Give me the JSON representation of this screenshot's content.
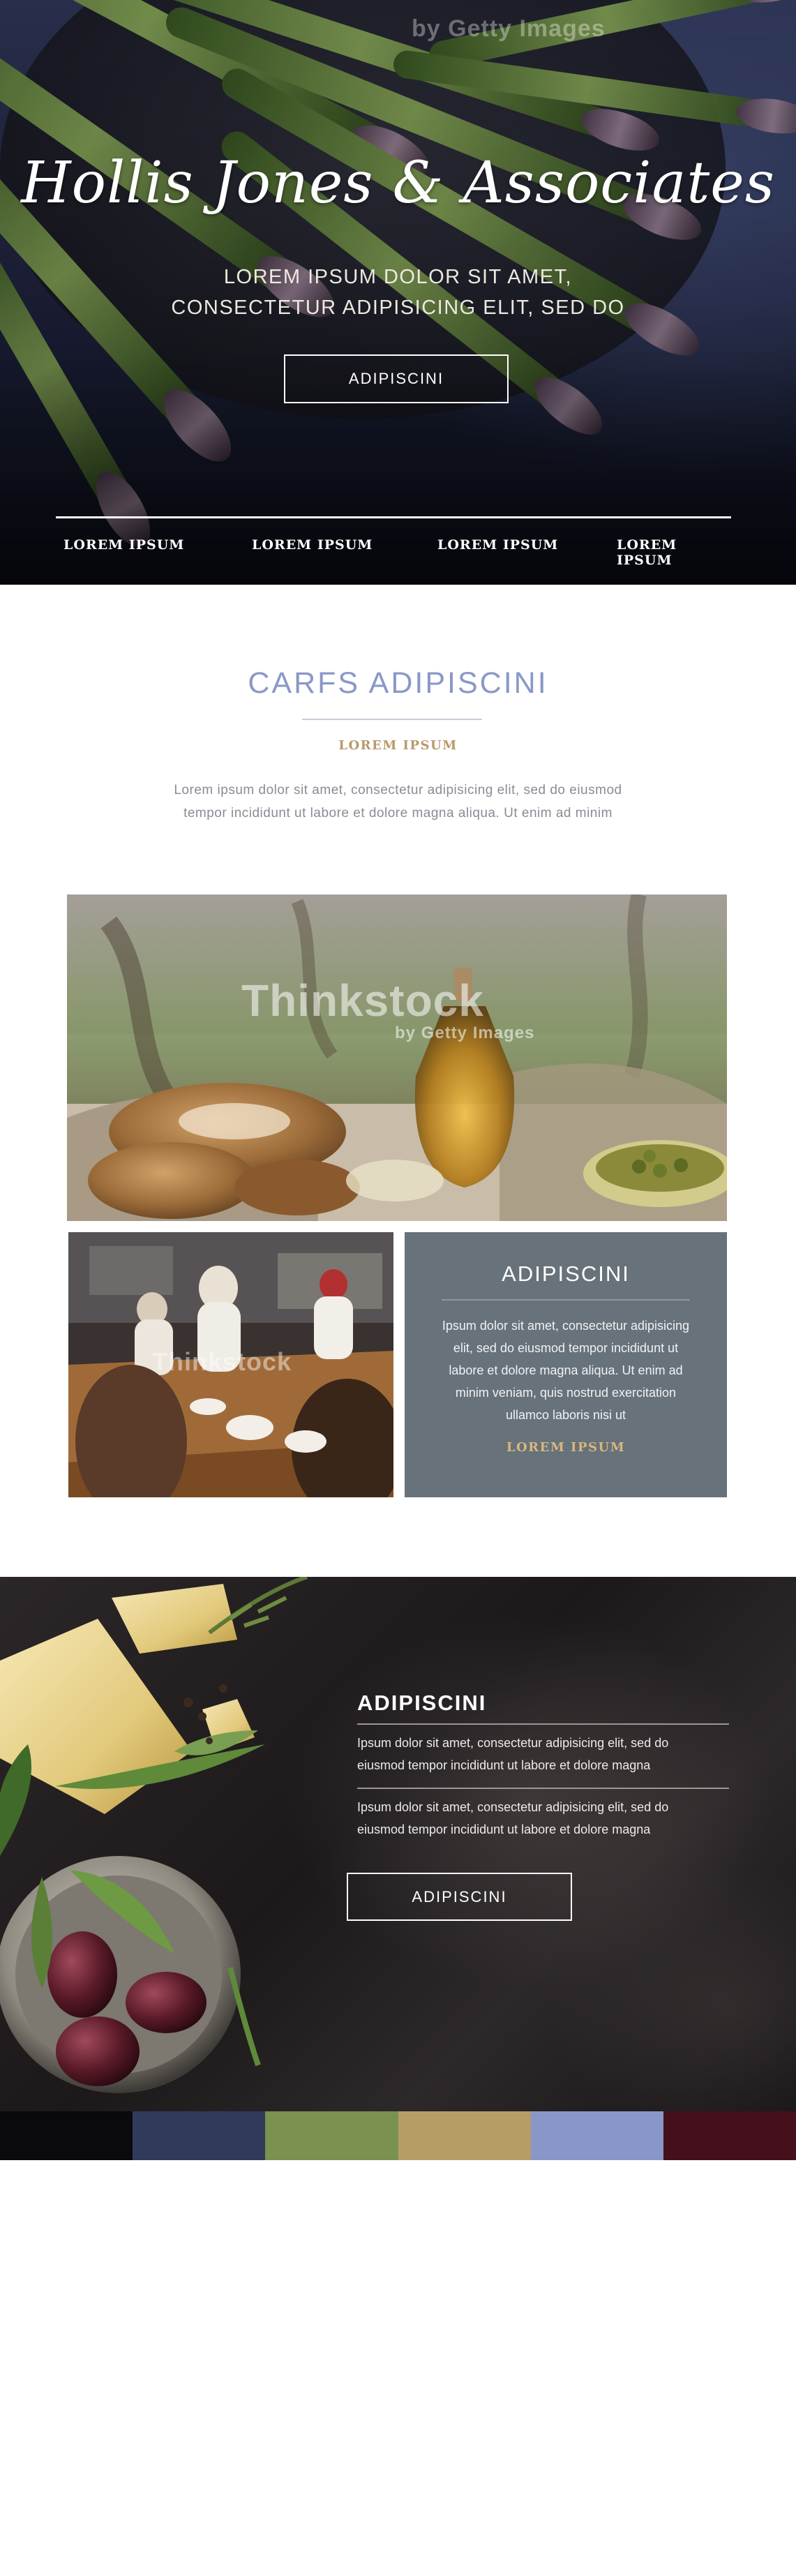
{
  "hero": {
    "title": "Hollis Jones & Associates",
    "subtitle_line1": "LOREM IPSUM DOLOR SIT AMET,",
    "subtitle_line2": "CONSECTETUR ADIPISICING ELIT, SED DO",
    "button_label": "ADIPISCINI",
    "nav": [
      "LOREM IPSUM",
      "LOREM IPSUM",
      "LOREM IPSUM",
      "LOREM IPSUM"
    ],
    "watermark": "by Getty Images"
  },
  "intro": {
    "title": "CARFS ADIPISCINI",
    "subtitle": "LOREM IPSUM",
    "body_line1": "Lorem ipsum dolor sit amet, consectetur adipisicing elit, sed do eiusmod",
    "body_line2": "tempor incididunt ut labore et dolore magna aliqua. Ut enim ad minim"
  },
  "gallery": {
    "main_watermark": "Thinkstock",
    "main_watermark_sub": "by Getty Images",
    "kitchen_watermark": "Thinkstock"
  },
  "card": {
    "title": "ADIPISCINI",
    "body_line1": "Ipsum dolor sit amet, consectetur adipisicing",
    "body_line2": "elit, sed do eiusmod tempor incididunt ut",
    "body_line3": "labore et dolore magna aliqua. Ut enim ad",
    "body_line4": "minim veniam, quis nostrud exercitation",
    "body_line5": "ullamco laboris nisi ut",
    "link": "LOREM IPSUM"
  },
  "feature": {
    "title": "ADIPISCINI",
    "para1_line1": "Ipsum dolor sit amet, consectetur adipisicing elit, sed do",
    "para1_line2": "eiusmod tempor incididunt ut labore et dolore magna",
    "para2_line1": "Ipsum dolor sit amet, consectetur adipisicing elit, sed do",
    "para2_line2": "eiusmod tempor incididunt ut labore et dolore magna",
    "button_label": "ADIPISCINI"
  },
  "palette": {
    "colors": [
      "#0a0a0c",
      "#323a5c",
      "#7a9150",
      "#b69d67",
      "#8896c8",
      "#45101c"
    ]
  },
  "colors": {
    "accent_blue": "#8a98c8",
    "accent_gold": "#b79a6a",
    "card_grey": "#67727a"
  }
}
